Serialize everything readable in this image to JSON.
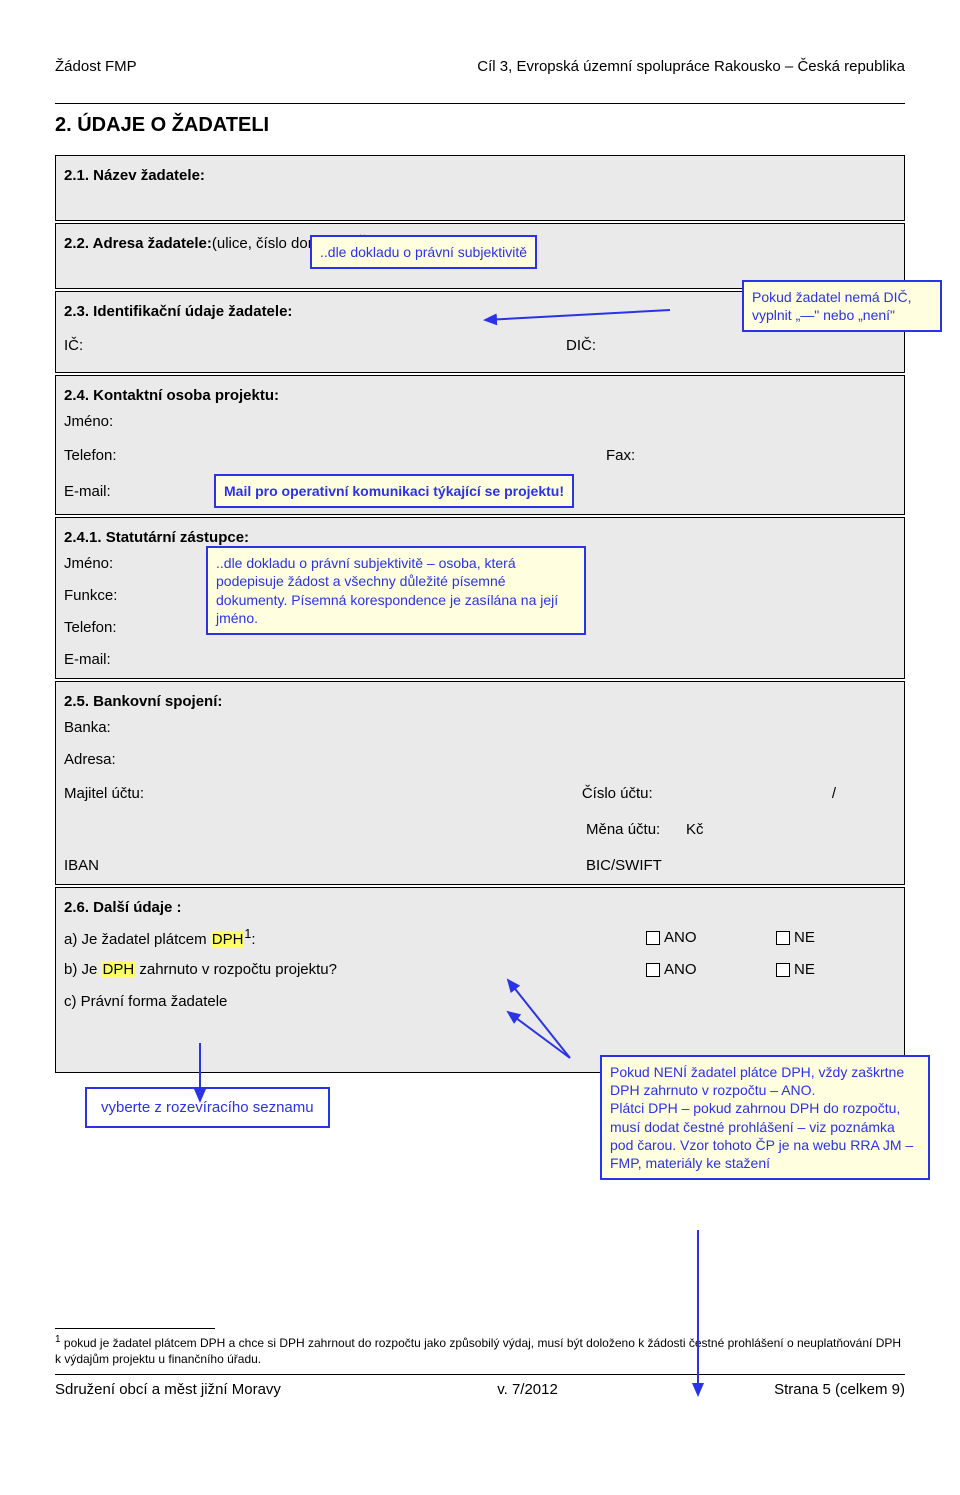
{
  "header": {
    "left": "Žádost FMP",
    "right": "Cíl 3, Evropská územní spolupráce Rakousko – Česká republika"
  },
  "section_title": "2. ÚDAJE O ŽADATELI",
  "block21": {
    "label": "2.1. Název žadatele:"
  },
  "block22": {
    "label": "2.2. Adresa žadatele: ",
    "sub": "(ulice, číslo domu, PSČ, město)"
  },
  "note_doklad": "..dle dokladu o právní subjektivitě",
  "block23": {
    "label": "2.3. Identifikační údaje žadatele:",
    "ic": "IČ:",
    "dic": "DIČ:"
  },
  "note_dic": "Pokud žadatel nemá DIČ, vyplnit „—\" nebo „není\"",
  "block24": {
    "label": "2.4. Kontaktní osoba projektu:",
    "jmeno": "Jméno:",
    "telefon": "Telefon:",
    "fax": "Fax:",
    "email": "E-mail:"
  },
  "note_mail": "Mail pro operativní komunikaci týkající se projektu!",
  "block241": {
    "label": "2.4.1. Statutární zástupce:",
    "jmeno": "Jméno:",
    "funkce": "Funkce:",
    "telefon": "Telefon:",
    "email": "E-mail:"
  },
  "note_statut": "..dle dokladu o právní subjektivitě – osoba, která podepisuje žádost a všechny důležité písemné dokumenty. Písemná korespondence je zasílána na její jméno.",
  "block25": {
    "label": "2.5. Bankovní spojení:",
    "banka": "Banka:",
    "adresa": "Adresa:",
    "majitel": "Majitel účtu:",
    "cislo": "Číslo účtu:",
    "slash": "/",
    "mena_label": "Měna účtu:",
    "mena_val": "Kč",
    "iban": "IBAN",
    "bicswift": "BIC/SWIFT"
  },
  "block26": {
    "label": "2.6. Další údaje :",
    "a_pre": "a) Je žadatel plátcem ",
    "a_dph": "DPH",
    "a_sup": "1",
    "a_colon": ":",
    "b_pre": "b) Je ",
    "b_dph": "DPH",
    "b_post": " zahrnuto v rozpočtu projektu?",
    "ano": "ANO",
    "ne": "NE",
    "c": "c) Právní forma žadatele"
  },
  "select_label": "vyberte z rozevíracího seznamu",
  "note_dph": "Pokud NENÍ žadatel plátce DPH, vždy zaškrtne DPH zahrnuto v rozpočtu – ANO.\nPlátci DPH – pokud zahrnou DPH do rozpočtu, musí dodat čestné prohlášení – viz poznámka pod čarou. Vzor tohoto ČP je na webu RRA JM – FMP, materiály ke stažení",
  "footnote_marker": "1",
  "footnote": " pokud je žadatel plátcem DPH a chce si DPH zahrnout do rozpočtu jako způsobilý výdaj, musí být doloženo k žádosti čestné prohlášení o neuplatňování DPH k výdajům projektu u finančního úřadu.",
  "footer": {
    "left": "Sdružení obcí a měst jižní Moravy",
    "center": "v. 7/2012",
    "right": "Strana 5 (celkem 9)"
  }
}
